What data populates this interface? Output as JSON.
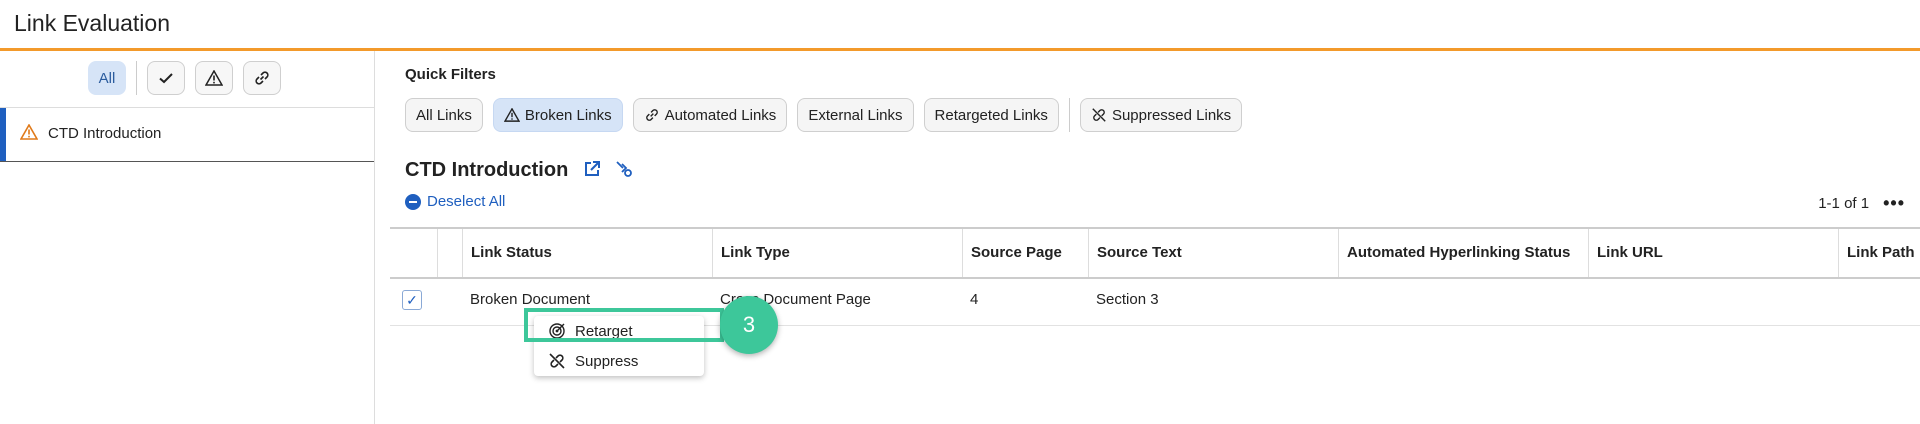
{
  "header": {
    "title": "Link Evaluation"
  },
  "left": {
    "filters": [
      {
        "label": "All",
        "icon": "text",
        "active": true
      },
      {
        "label": "",
        "icon": "check-icon"
      },
      {
        "label": "",
        "icon": "warning-icon"
      },
      {
        "label": "",
        "icon": "link-icon"
      }
    ],
    "nav_item": {
      "label": "CTD Introduction",
      "icon": "warning-icon",
      "color": "#e07a1a"
    }
  },
  "quick_filters": {
    "title": "Quick Filters",
    "chips": [
      "All Links",
      "Broken Links",
      "Automated Links",
      "External Links",
      "Retargeted Links",
      "Suppressed Links"
    ],
    "active": "Broken Links"
  },
  "section": {
    "title": "CTD Introduction",
    "deselect_label": "Deselect All",
    "pager": "1-1 of 1"
  },
  "table": {
    "columns": [
      "Link Status",
      "Link Type",
      "Source Page",
      "Source Text",
      "Automated Hyperlinking Status",
      "Link URL",
      "Link Path"
    ],
    "rows": [
      {
        "status": "Broken Document",
        "type": "Cross Document Page",
        "page": "4",
        "text": "Section 3",
        "auto": "",
        "url": "",
        "path": ""
      }
    ]
  },
  "context_menu": {
    "items": [
      "Retarget",
      "Suppress"
    ]
  },
  "step_badge": "3",
  "colors": {
    "accent": "#f39a2b",
    "primary": "#1f5fbf",
    "highlight": "#3dc79a"
  }
}
